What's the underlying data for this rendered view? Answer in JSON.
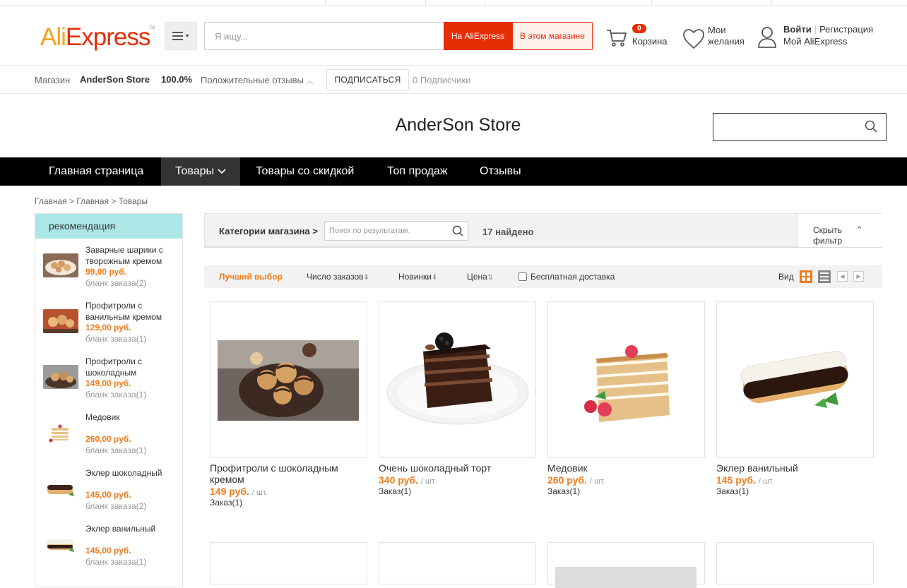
{
  "header": {
    "logo": "AliExpress",
    "search_placeholder": "Я ищу...",
    "btn_ali": "На AliExpress",
    "btn_store": "В этом магазине",
    "cart_count": "0",
    "cart_label": "Корзина",
    "wish_label": "Мои желания",
    "login": "Войти",
    "register": "Регистрация",
    "my_ali": "Мой AliExpress"
  },
  "store_bar": {
    "label": "Магазин",
    "name": "AnderSon Store",
    "feedback_pct": "100.0%",
    "feedback_label": "Положительные отзывы",
    "subscribe": "ПОДПИСАТЬСЯ",
    "subscribers": "0 Подписчики"
  },
  "store_title": "AnderSon Store",
  "nav": {
    "home": "Главная страница",
    "products": "Товары",
    "sale": "Товары со скидкой",
    "top": "Топ продаж",
    "reviews": "Отзывы"
  },
  "breadcrumb": "Главная > Главная > Товары",
  "sidebar": {
    "title": "рекомендация",
    "items": [
      {
        "title": "Заварные шарики с творожным кремом",
        "price": "99,00 руб.",
        "orders": "бланк заказа(2)"
      },
      {
        "title": "Профитроли с ванильным кремом",
        "price": "129,00 руб.",
        "orders": "бланк заказа(1)"
      },
      {
        "title": "Профитроли с шоколадным",
        "price": "149,00 руб.",
        "orders": "бланк заказа(1)"
      },
      {
        "title": "Медовик",
        "price": "260,00 руб.",
        "orders": "бланк заказа(1)"
      },
      {
        "title": "Эклер шоколадный",
        "price": "145,00 руб.",
        "orders": "бланк заказа(2)"
      },
      {
        "title": "Эклер ванильный",
        "price": "145,00 руб.",
        "orders": "бланк заказа(1)"
      }
    ]
  },
  "filter": {
    "categories": "Категории магазина >",
    "search_placeholder": "Поиск по результатам.",
    "found": "17 найдено",
    "hide_filter": "Скрыть фильтр"
  },
  "sort": {
    "best": "Лучший выбор",
    "orders": "Число заказов",
    "new": "Новинки",
    "price": "Цена",
    "free_shipping": "Бесплатная доставка",
    "view": "Вид"
  },
  "products": [
    {
      "name": "Профитроли с шоколадным кремом",
      "price": "149 руб.",
      "unit": "/ шт.",
      "orders": "Заказ(1)"
    },
    {
      "name": "Очень шоколадный торт",
      "price": "340 руб.",
      "unit": "/ шт.",
      "orders": "Заказ(1)"
    },
    {
      "name": "Медовик",
      "price": "260 руб.",
      "unit": "/ шт.",
      "orders": "Заказ(1)"
    },
    {
      "name": "Эклер ванильный",
      "price": "145 руб.",
      "unit": "/ шт.",
      "orders": "Заказ(1)"
    }
  ],
  "colors": {
    "ali_red": "#e62e04",
    "price_orange": "#f07b1b",
    "nav_black": "#000000",
    "sidebar_head": "#abe7e7"
  }
}
